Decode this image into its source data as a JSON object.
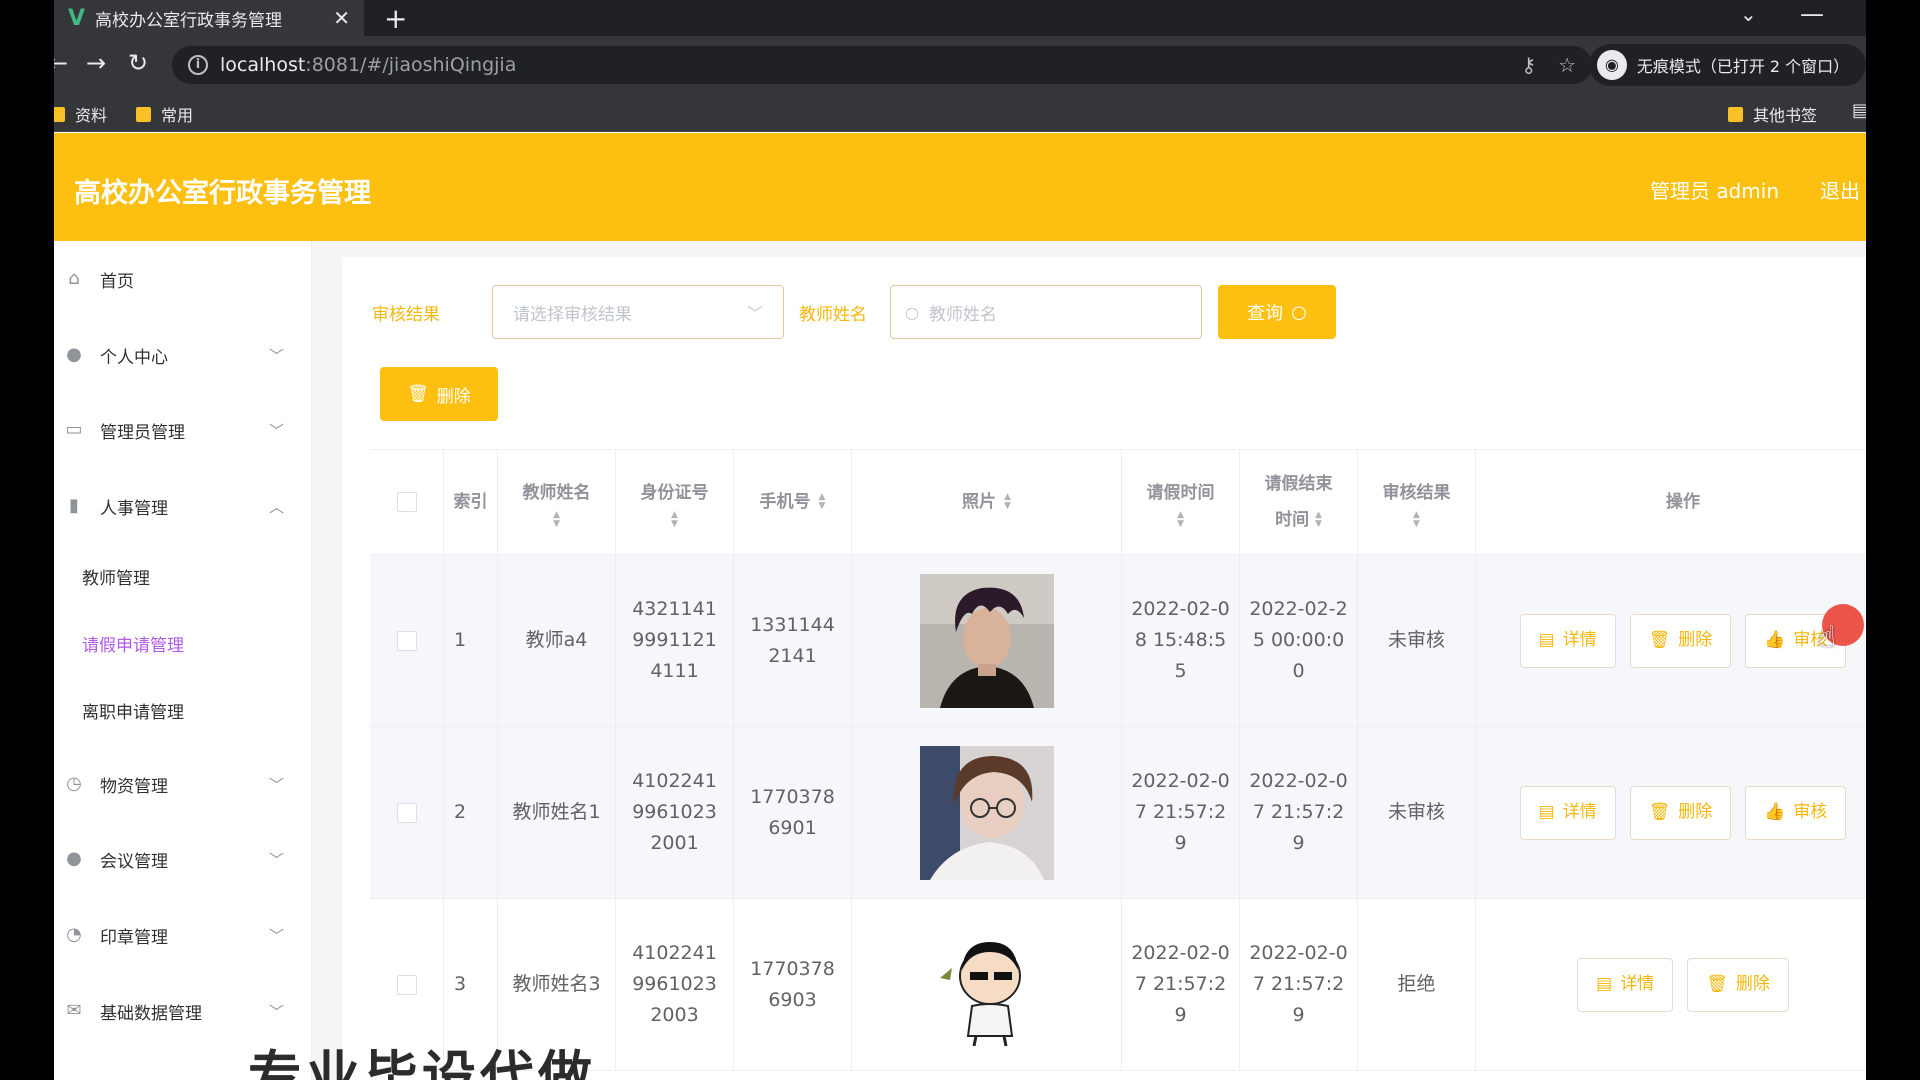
{
  "browser": {
    "tab_title": "高校办公室行政事务管理",
    "url_host": "localhost",
    "url_path": ":8081/#/jiaoshiQingjia",
    "incognito_label": "无痕模式（已打开 2 个窗口）",
    "bookmarks": [
      "资料",
      "常用"
    ],
    "other_bookmarks": "其他书签"
  },
  "header": {
    "title": "高校办公室行政事务管理",
    "user": "管理员 admin",
    "logout": "退出"
  },
  "sidebar": {
    "items": [
      {
        "label": "首页",
        "icon": "home-icon"
      },
      {
        "label": "个人中心",
        "icon": "user-icon"
      },
      {
        "label": "管理员管理",
        "icon": "id-card-icon"
      },
      {
        "label": "人事管理",
        "icon": "chart-icon"
      },
      {
        "label": "物资管理",
        "icon": "compass-icon"
      },
      {
        "label": "会议管理",
        "icon": "location-icon"
      },
      {
        "label": "印章管理",
        "icon": "clock-icon"
      },
      {
        "label": "基础数据管理",
        "icon": "mail-icon"
      }
    ],
    "sub_items": [
      {
        "label": "教师管理"
      },
      {
        "label": "请假申请管理"
      },
      {
        "label": "离职申请管理"
      }
    ]
  },
  "filters": {
    "review_label": "审核结果",
    "review_placeholder": "请选择审核结果",
    "teacher_label": "教师姓名",
    "teacher_placeholder": "教师姓名",
    "query_button": "查询",
    "delete_button": "删除"
  },
  "table": {
    "headers": {
      "index": "索引",
      "name": "教师姓名",
      "id": "身份证号",
      "phone": "手机号",
      "photo": "照片",
      "start": "请假时间",
      "end_line1": "请假结束",
      "end_line2": "时间",
      "result": "审核结果",
      "ops": "操作"
    },
    "rows": [
      {
        "index": "1",
        "name": "教师a4",
        "id": "432114199911214111",
        "phone": "13311442141",
        "start": "2022-02-08 15:48:55",
        "end": "2022-02-25 00:00:00",
        "result": "未审核"
      },
      {
        "index": "2",
        "name": "教师姓名1",
        "id": "410224199610232001",
        "phone": "17703786901",
        "start": "2022-02-07 21:57:29",
        "end": "2022-02-07 21:57:29",
        "result": "未审核"
      },
      {
        "index": "3",
        "name": "教师姓名3",
        "id": "410224199610232003",
        "phone": "17703786903",
        "start": "2022-02-07 21:57:29",
        "end": "2022-02-07 21:57:29",
        "result": "拒绝"
      }
    ],
    "ops": {
      "detail": "详情",
      "delete": "删除",
      "review": "审核"
    }
  },
  "overlay_text": "专业毕设代做",
  "colors": {
    "accent": "#fdc011",
    "active_menu": "#b15ae8",
    "label": "#f4b70c"
  }
}
